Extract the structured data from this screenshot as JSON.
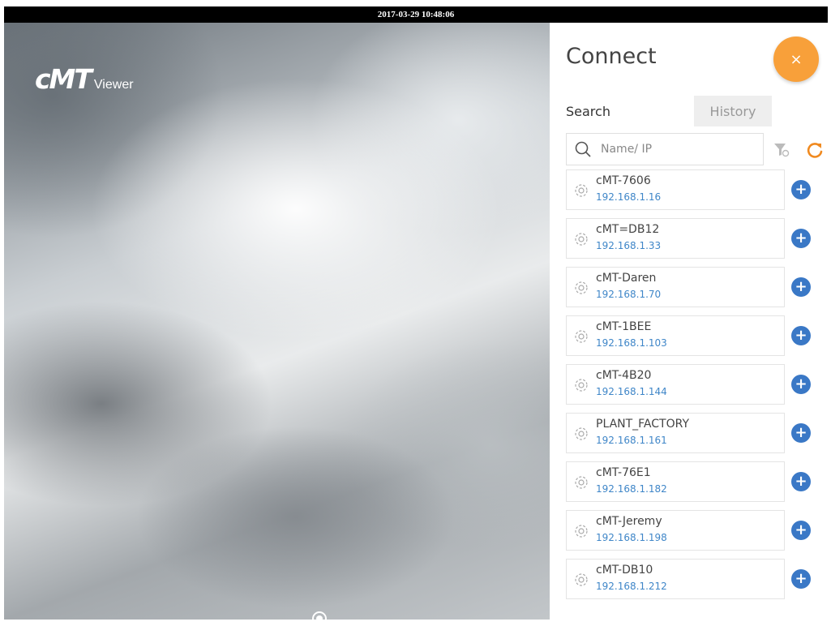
{
  "timestamp": "2017-03-29 10:48:06",
  "logo": {
    "main": "cMT",
    "sub": "Viewer"
  },
  "panel": {
    "title": "Connect",
    "close_label": "×",
    "tabs": [
      {
        "label": "Search",
        "active": true
      },
      {
        "label": "History",
        "active": false
      }
    ],
    "search": {
      "placeholder": "Name/ IP",
      "value": ""
    }
  },
  "devices": [
    {
      "name": "cMT-7606",
      "ip": "192.168.1.16"
    },
    {
      "name": "cMT=DB12",
      "ip": "192.168.1.33"
    },
    {
      "name": "cMT-Daren",
      "ip": "192.168.1.70"
    },
    {
      "name": "cMT-1BEE",
      "ip": "192.168.1.103"
    },
    {
      "name": "cMT-4B20",
      "ip": "192.168.1.144"
    },
    {
      "name": "PLANT_FACTORY",
      "ip": "192.168.1.161"
    },
    {
      "name": "cMT-76E1",
      "ip": "192.168.1.182"
    },
    {
      "name": "cMT-Jeremy",
      "ip": "192.168.1.198"
    },
    {
      "name": "cMT-DB10",
      "ip": "192.168.1.212"
    }
  ],
  "add_label": "+",
  "colors": {
    "accent_orange": "#f8a03a",
    "add_blue": "#3a78c6",
    "ip_blue": "#3f86c8",
    "refresh_orange": "#f08a20"
  },
  "icons": {
    "device": "gear-icon",
    "search": "search-icon",
    "filter": "filter-icon",
    "refresh": "refresh-icon",
    "home": "home-button-icon"
  }
}
